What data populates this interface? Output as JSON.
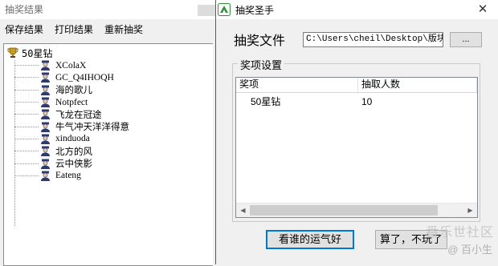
{
  "results_window": {
    "title": "抽奖结果",
    "menu": [
      "保存结果",
      "打印结果",
      "重新抽奖"
    ],
    "tree": {
      "root_label": "50星钻",
      "items": [
        "XColaX",
        "GC_Q4IHOQH",
        "海的歌儿",
        "Notpfect",
        "飞龙在冠途",
        "牛气冲天洋洋得意",
        "xinduoda",
        "北方的风",
        "云中侠影",
        "Eateng"
      ]
    }
  },
  "lottery_window": {
    "title": "抽奖圣手",
    "close_glyph": "✕",
    "file_label": "抽奖文件",
    "file_path": "C:\\Users\\cheil\\Desktop\\版块活",
    "browse_label": "...",
    "group_title": "奖项设置",
    "list_columns": [
      "奖项",
      "抽取人数"
    ],
    "list_rows": [
      {
        "prize": "50星钻",
        "count": "10"
      }
    ],
    "scroll_left": "◀",
    "scroll_right": "▶",
    "draw_button": "看谁的运气好",
    "quit_button": "算了，不玩了"
  },
  "watermark": {
    "line1": "番乐世社区",
    "line2": "@ 百小生"
  },
  "colors": {
    "accent": "#0078d7",
    "background": "#f0f0f0",
    "trophy": "#c99a1c",
    "user_icon": "#2e3a6b",
    "app_icon": "#2f8f3a"
  }
}
